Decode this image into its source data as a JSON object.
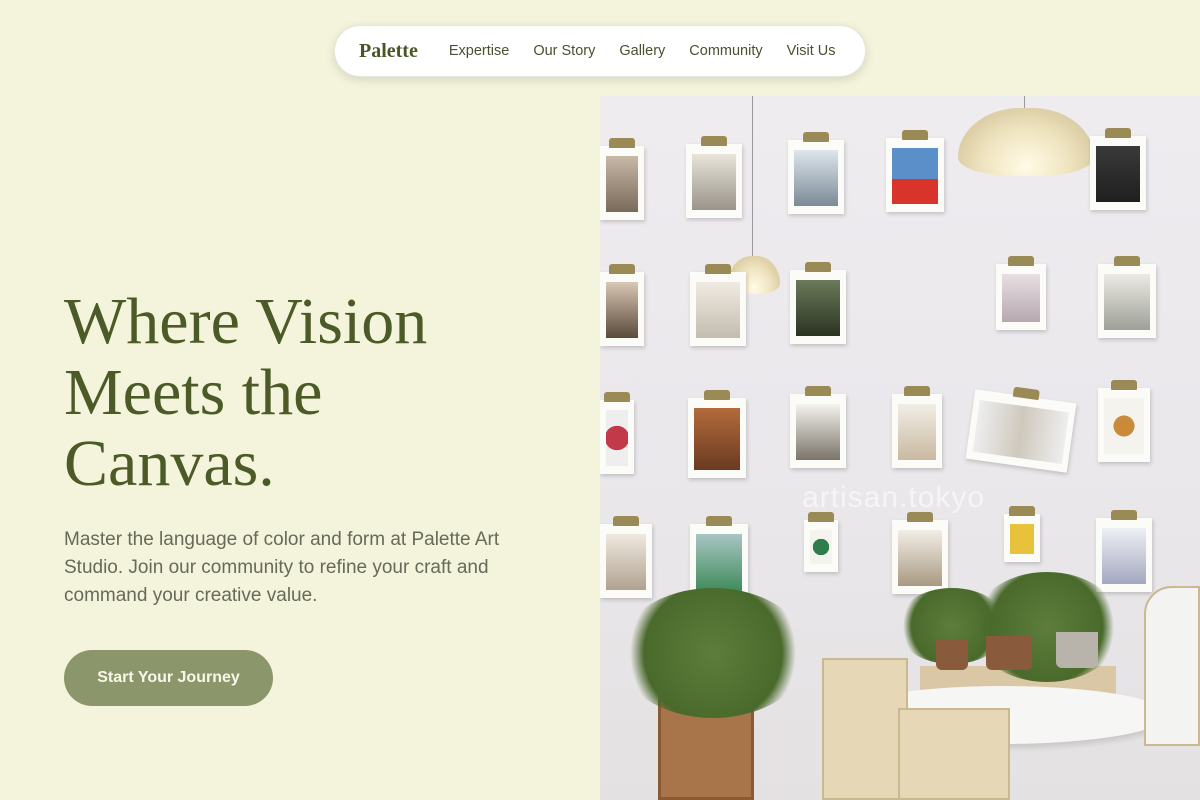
{
  "nav": {
    "brand": "Palette",
    "links": [
      "Expertise",
      "Our Story",
      "Gallery",
      "Community",
      "Visit Us"
    ]
  },
  "hero": {
    "headline_lines": [
      "Where Vision",
      "Meets the",
      "Canvas."
    ],
    "subtext": "Master the language of color and form at Palette Art Studio. Join our community to refine your craft and command your creative value.",
    "cta_label": "Start Your Journey"
  },
  "photo": {
    "watermark": "artisan.tokyo"
  },
  "colors": {
    "background": "#f4f4dc",
    "headline": "#4b5a26",
    "cta": "#8b976a",
    "nav_bg": "#ffffff"
  }
}
